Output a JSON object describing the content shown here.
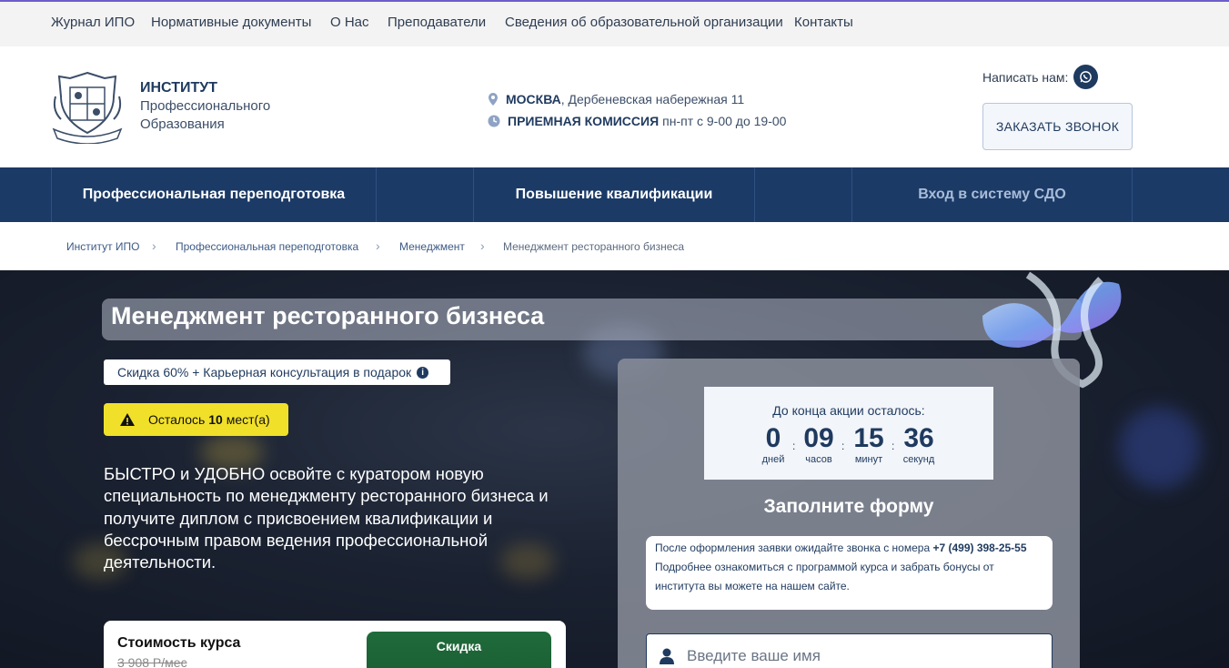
{
  "topnav": [
    "Журнал ИПО",
    "Нормативные документы",
    "О Нас",
    "Преподаватели",
    "Сведения об образовательной организации",
    "Контакты"
  ],
  "brand": {
    "line1": "ИНСТИТУТ",
    "line2": "Профессионального",
    "line3": "Образования"
  },
  "contacts": {
    "city": "МОСКВА",
    "address": ", Дербеневская набережная 11",
    "admission": "ПРИЕМНАЯ КОМИССИЯ",
    "hours": "пн-пт с 9-00 до 19-00"
  },
  "write_us": "Написать нам:",
  "call_button": "ЗАКАЗАТЬ ЗВОНОК",
  "mainnav": [
    "Профессиональная переподготовка",
    "Повышение квалификации",
    "Вход в систему СДО"
  ],
  "breadcrumbs": [
    "Институт ИПО",
    "Профессиональная переподготовка",
    "Менеджмент",
    "Менеджмент ресторанного бизнеса"
  ],
  "hero": {
    "title": "Менеджмент ресторанного бизнеса",
    "discount": "Скидка 60% + Карьерная консультация в подарок",
    "places_prefix": "Осталось",
    "places_count": "10",
    "places_suffix": "мест(а)",
    "lead": "БЫСТРО и УДОБНО освойте с куратором новую специальность по менеджменту ресторанного бизнеса и получите диплом с присвоением квалификации и бессрочным правом ведения профессиональной деятельности."
  },
  "price": {
    "title": "Стоимость курса",
    "old": "3 908 Р/мес",
    "badge": "Скидка"
  },
  "timer": {
    "caption": "До конца акции осталось:",
    "days": "0",
    "hours": "09",
    "minutes": "15",
    "seconds": "36",
    "days_label": "дней",
    "hours_label": "часов",
    "minutes_label": "минут",
    "seconds_label": "секунд"
  },
  "form": {
    "heading": "Заполните форму",
    "note_1": "После оформления заявки ожидайте звонка с номера ",
    "phone": "+7 (499) 398-25-55",
    "note_2": "Подробнее ознакомиться с программой курса и забрать бонусы от института вы можете на нашем сайте.",
    "name_placeholder": "Введите ваше имя"
  },
  "colors": {
    "navy": "#1b3a66",
    "yellow": "#f1e02a",
    "accent_purple": "#6b5fc9"
  }
}
